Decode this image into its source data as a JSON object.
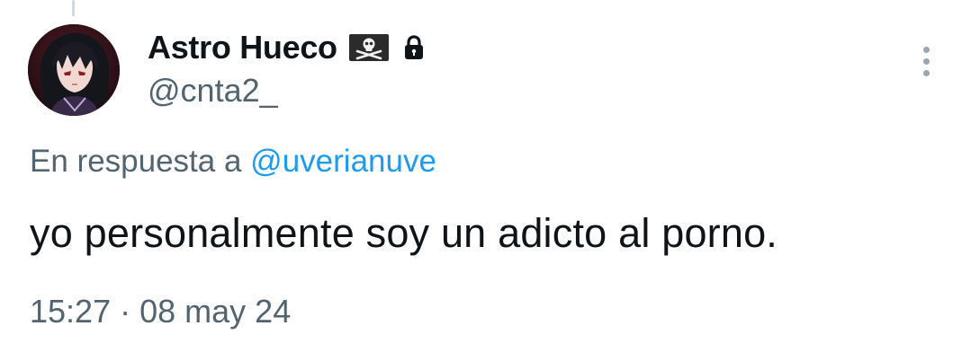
{
  "tweet": {
    "author": {
      "display_name": "Astro Hueco",
      "handle": "@cnta2_",
      "avatar_icon": "anime-avatar",
      "badges": [
        "pirate-flag-icon",
        "lock-icon"
      ]
    },
    "reply_prefix": "En respuesta a",
    "reply_to": "@uverianuve",
    "text": "yo personalmente soy un adicto al porno.",
    "time": "15:27",
    "separator": "·",
    "date": "08 may 24",
    "more_icon": "more-vertical-icon"
  },
  "colors": {
    "text_primary": "#0f1419",
    "text_secondary": "#536471",
    "link": "#1d9bf0",
    "background": "#ffffff"
  }
}
